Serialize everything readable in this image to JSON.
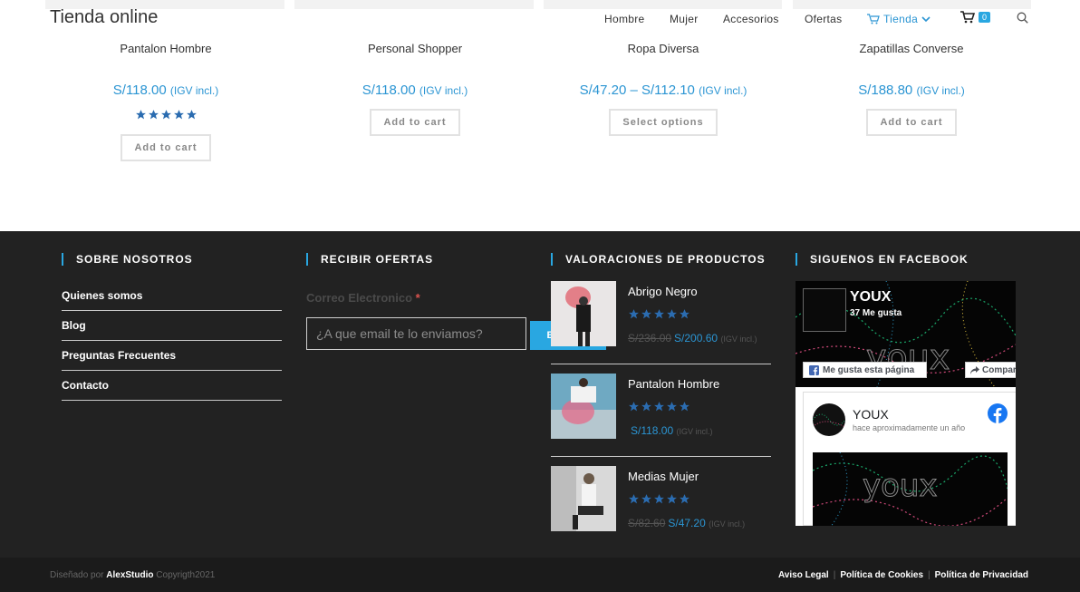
{
  "header": {
    "site_title": "Tienda online",
    "nav": [
      {
        "label": "Hombre"
      },
      {
        "label": "Mujer"
      },
      {
        "label": "Accesorios"
      },
      {
        "label": "Ofertas"
      },
      {
        "label": "Tienda"
      }
    ],
    "cart_count": "0"
  },
  "products": [
    {
      "name": "Pantalon Hombre",
      "price": "S/118.00",
      "igv": "(IGV incl.)",
      "rating": 5,
      "button": "Add to cart"
    },
    {
      "name": "Personal Shopper",
      "price": "S/118.00",
      "igv": "(IGV incl.)",
      "rating": 0,
      "button": "Add to cart"
    },
    {
      "name": "Ropa Diversa",
      "price": "S/47.20 – S/112.10",
      "igv": "(IGV incl.)",
      "rating": 0,
      "button": "Select options"
    },
    {
      "name": "Zapatillas Converse",
      "price": "S/188.80",
      "igv": "(IGV incl.)",
      "rating": 0,
      "button": "Add to cart"
    }
  ],
  "footer": {
    "about": {
      "title": "SOBRE NOSOTROS",
      "links": [
        "Quienes somos",
        "Blog",
        "Preguntas Frecuentes",
        "Contacto"
      ]
    },
    "offers": {
      "title": "RECIBIR OFERTAS",
      "email_label": "Correo Electronico",
      "required_mark": "*",
      "email_placeholder": "¿A que email te lo enviamos?",
      "send_label": "ENVIAR"
    },
    "reviews": {
      "title": "VALORACIONES DE PRODUCTOS",
      "items": [
        {
          "name": "Abrigo Negro",
          "old_price": "S/236.00",
          "price": "S/200.60",
          "igv": "(IGV incl.)",
          "rating": 5
        },
        {
          "name": "Pantalon Hombre",
          "old_price": "",
          "price": "S/118.00",
          "igv": "(IGV incl.)",
          "rating": 5
        },
        {
          "name": "Medias Mujer",
          "old_price": "S/82.60",
          "price": "S/47.20",
          "igv": "(IGV incl.)",
          "rating": 5
        }
      ]
    },
    "facebook": {
      "title": "SIGUENOS EN FACEBOOK",
      "page_name": "YOUX",
      "likes": "37 Me gusta",
      "like_button": "Me gusta esta página",
      "share_button": "Compartir",
      "post_name": "YOUX",
      "post_time": "hace aproximadamente un año",
      "cover_text": "youx"
    }
  },
  "bottom": {
    "credits_prefix": "Diseñado por",
    "credits_name": "AlexStudio",
    "credits_suffix": "Copyrigth2021",
    "legal": [
      "Aviso Legal",
      "Política de Cookies",
      "Política de Privacidad"
    ]
  },
  "colors": {
    "accent": "#29a7e1",
    "price": "#2b95d3",
    "footer_bg": "#222222",
    "star": "#2b6cb0"
  }
}
